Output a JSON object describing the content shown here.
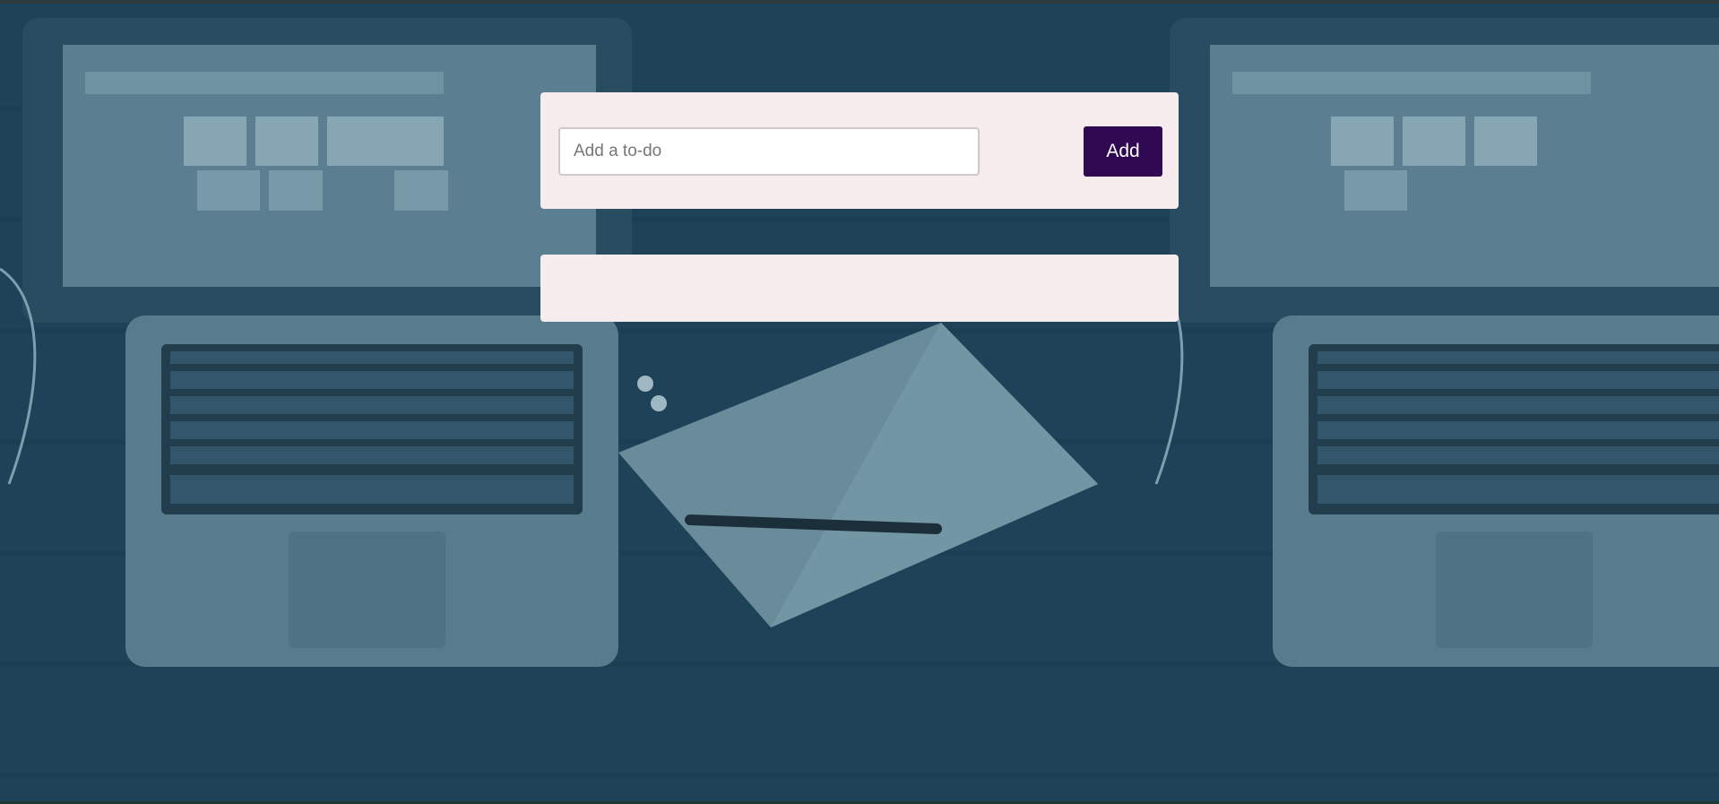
{
  "form": {
    "input_placeholder": "Add a to-do",
    "input_value": "",
    "add_label": "Add"
  },
  "todos": [],
  "colors": {
    "background_tint": "#1e3f52",
    "card_background": "#f7eced",
    "button_background": "#2f0a52",
    "button_text": "#ffffff"
  }
}
